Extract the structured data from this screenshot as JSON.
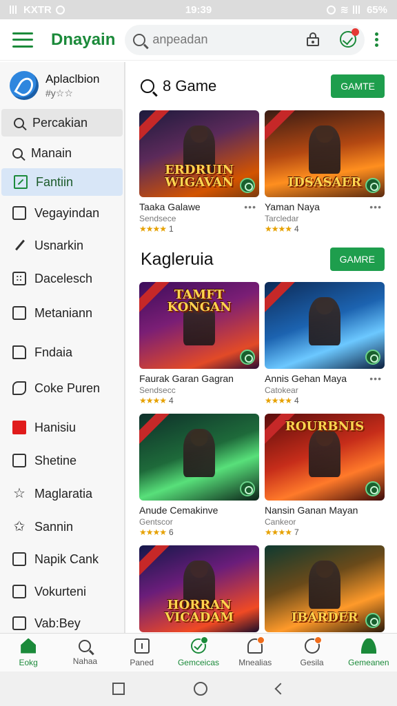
{
  "status_bar": {
    "carrier": "KXTR",
    "time": "19:39",
    "battery": "65%"
  },
  "header": {
    "title": "Dnayain",
    "search_placeholder": "anpeadan"
  },
  "sidebar": {
    "profile_name": "Aplaclbion",
    "profile_sub": "#y☆☆",
    "items": [
      {
        "label": "Percakian",
        "icon": "search-icon"
      },
      {
        "label": "Manain",
        "icon": "search-icon"
      },
      {
        "label": "Fantiin",
        "icon": "edit-box-icon"
      },
      {
        "label": "Vegayindan",
        "icon": "box-icon"
      },
      {
        "label": "Usnarkin",
        "icon": "pen-icon"
      },
      {
        "label": "Dacelesch",
        "icon": "grid-icon"
      },
      {
        "label": "Metaniann",
        "icon": "box-icon"
      },
      {
        "label": "Fndaia",
        "icon": "document-icon"
      },
      {
        "label": "Coke Puren",
        "icon": "puzzle-icon"
      },
      {
        "label": "Hanisiu",
        "icon": "red-square-icon"
      },
      {
        "label": "Shetine",
        "icon": "box-icon"
      },
      {
        "label": "Maglaratia",
        "icon": "star-icon"
      },
      {
        "label": "Sannin",
        "icon": "star-icon"
      },
      {
        "label": "Napik Cank",
        "icon": "box-icon"
      },
      {
        "label": "Vokurteni",
        "icon": "box-icon"
      },
      {
        "label": "Vab:Bey",
        "icon": "box-icon"
      }
    ]
  },
  "main": {
    "section1": {
      "title": "8 Game",
      "button": "GAMTE",
      "games": [
        {
          "name": "Taaka Galawe",
          "sub": "Sendsece",
          "rating": "1",
          "thumb_text": "ERDRUIN WIGAVAN"
        },
        {
          "name": "Yaman Naya",
          "sub": "Tarcledar",
          "rating": "4",
          "thumb_text": "IDSASAER"
        }
      ]
    },
    "section2": {
      "title": "Kagleruia",
      "button": "GAMRE",
      "games": [
        {
          "name": "Faurak Garan Gagran",
          "sub": "Sendsecc",
          "rating": "4",
          "thumb_text": "TAMFT KONGAN"
        },
        {
          "name": "Annis Gehan Maya",
          "sub": "Catokear",
          "rating": "4",
          "thumb_text": ""
        },
        {
          "name": "Anude Cemakinve",
          "sub": "Gentscor",
          "rating": "6",
          "thumb_text": ""
        },
        {
          "name": "Nansin Ganan Mayan",
          "sub": "Cankeor",
          "rating": "7",
          "thumb_text": "ROURBNIS"
        },
        {
          "name": "",
          "sub": "",
          "rating": "",
          "thumb_text": "HORRAN VICADAM"
        },
        {
          "name": "",
          "sub": "",
          "rating": "",
          "thumb_text": "IBARDER"
        }
      ]
    }
  },
  "bottom_nav": [
    {
      "label": "Eokg",
      "icon": "home-icon",
      "active": true
    },
    {
      "label": "Nahaa",
      "icon": "search-icon",
      "active": false
    },
    {
      "label": "Paned",
      "icon": "panel-icon",
      "active": false
    },
    {
      "label": "Gemceicas",
      "icon": "games-icon",
      "active": true
    },
    {
      "label": "Mnealias",
      "icon": "people-icon",
      "active": false
    },
    {
      "label": "Gesila",
      "icon": "circle-icon",
      "active": false
    },
    {
      "label": "Gemeanen",
      "icon": "person-icon",
      "active": true
    }
  ],
  "colors": {
    "brand_green": "#1b8a3a",
    "button_green": "#1e9e4d",
    "selected_blue": "#d8e6f7",
    "star_gold": "#e6a100"
  }
}
